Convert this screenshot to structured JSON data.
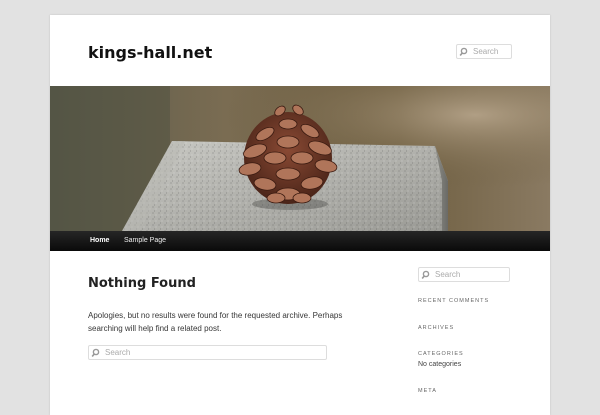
{
  "header": {
    "site_title": "kings-hall.net",
    "search_placeholder": "Search"
  },
  "nav": {
    "items": [
      {
        "label": "Home",
        "active": true
      },
      {
        "label": "Sample Page",
        "active": false
      }
    ]
  },
  "main": {
    "title": "Nothing Found",
    "message": "Apologies, but no results were found for the requested archive. Perhaps searching will help find a related post.",
    "search_placeholder": "Search"
  },
  "sidebar": {
    "search_placeholder": "Search",
    "widgets": {
      "recent_comments": "RECENT COMMENTS",
      "archives": "ARCHIVES",
      "categories": "CATEGORIES",
      "categories_empty": "No categories",
      "meta": "META"
    }
  },
  "colors": {
    "page_bg": "#e2e2e2",
    "nav_bg": "#161616",
    "accent": "#1b8be0"
  }
}
